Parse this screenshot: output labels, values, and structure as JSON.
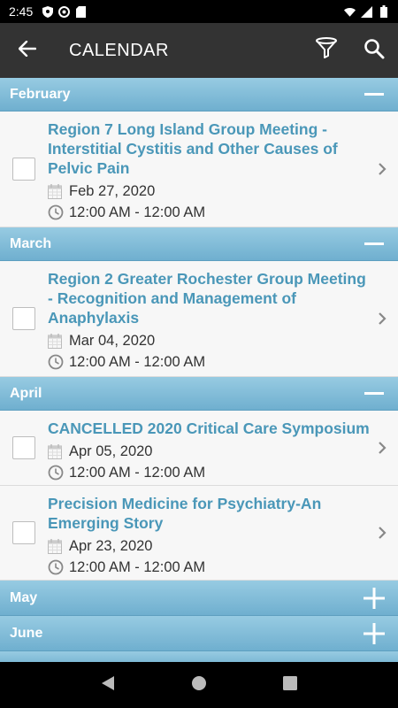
{
  "status_bar": {
    "time": "2:45",
    "left_icons": [
      "shield-icon",
      "at-sign-icon",
      "sd-card-icon"
    ],
    "right_icons": [
      "wifi-icon",
      "signal-icon",
      "battery-icon"
    ]
  },
  "app_bar": {
    "title": "CALENDAR",
    "back_icon": "arrow-left-icon",
    "filter_icon": "funnel-icon",
    "search_icon": "search-icon"
  },
  "colors": {
    "app_bar": "#333333",
    "month_header_top": "#97cbe2",
    "month_header_bottom": "#6fafcf",
    "event_title": "#4a97b8",
    "row_background": "#f7f7f7"
  },
  "months": [
    {
      "name": "February",
      "expanded": true,
      "toggle_icon": "minus-icon",
      "events": [
        {
          "title": "Region 7 Long Island Group Meeting - Interstitial Cystitis and Other Causes of Pelvic Pain",
          "date": "Feb 27, 2020",
          "time": "12:00 AM - 12:00 AM"
        }
      ]
    },
    {
      "name": "March",
      "expanded": true,
      "toggle_icon": "minus-icon",
      "events": [
        {
          "title": "Region 2 Greater Rochester Group Meeting - Recognition and Management of Anaphylaxis",
          "date": "Mar 04, 2020",
          "time": "12:00 AM - 12:00 AM"
        }
      ]
    },
    {
      "name": "April",
      "expanded": true,
      "toggle_icon": "minus-icon",
      "events": [
        {
          "title": "CANCELLED 2020 Critical Care Symposium",
          "date": "Apr 05, 2020",
          "time": "12:00 AM - 12:00 AM"
        },
        {
          "title": "Precision Medicine for Psychiatry-An Emerging Story",
          "date": "Apr 23, 2020",
          "time": "12:00 AM - 12:00 AM"
        }
      ]
    },
    {
      "name": "May",
      "expanded": false,
      "toggle_icon": "plus-icon",
      "events": []
    },
    {
      "name": "June",
      "expanded": false,
      "toggle_icon": "plus-icon",
      "events": []
    }
  ],
  "nav_bar": {
    "back": "triangle-back-icon",
    "home": "circle-home-icon",
    "recents": "square-recents-icon"
  }
}
